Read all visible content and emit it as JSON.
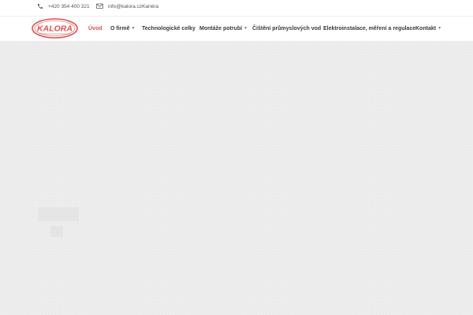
{
  "topbar": {
    "phone": "+420 354 400 321",
    "email": "info@kalora.czKariéra"
  },
  "logo": {
    "text": "KALORA"
  },
  "menu": {
    "items": [
      {
        "label": "Úvod",
        "active": true,
        "dropdown": false
      },
      {
        "label": "O firmě",
        "active": false,
        "dropdown": true
      },
      {
        "label": "Technologické celky",
        "active": false,
        "dropdown": false
      },
      {
        "label": "Montáže potrubí",
        "active": false,
        "dropdown": true
      },
      {
        "label": "Čištění průmyslových vod",
        "active": false,
        "dropdown": false
      },
      {
        "label": "Elektroinstalace, měření a regulace",
        "active": false,
        "dropdown": false
      },
      {
        "label": "Kontakt",
        "active": false,
        "dropdown": true
      }
    ]
  },
  "colors": {
    "accent": "#d9534f",
    "hero_bg": "#ededed"
  }
}
